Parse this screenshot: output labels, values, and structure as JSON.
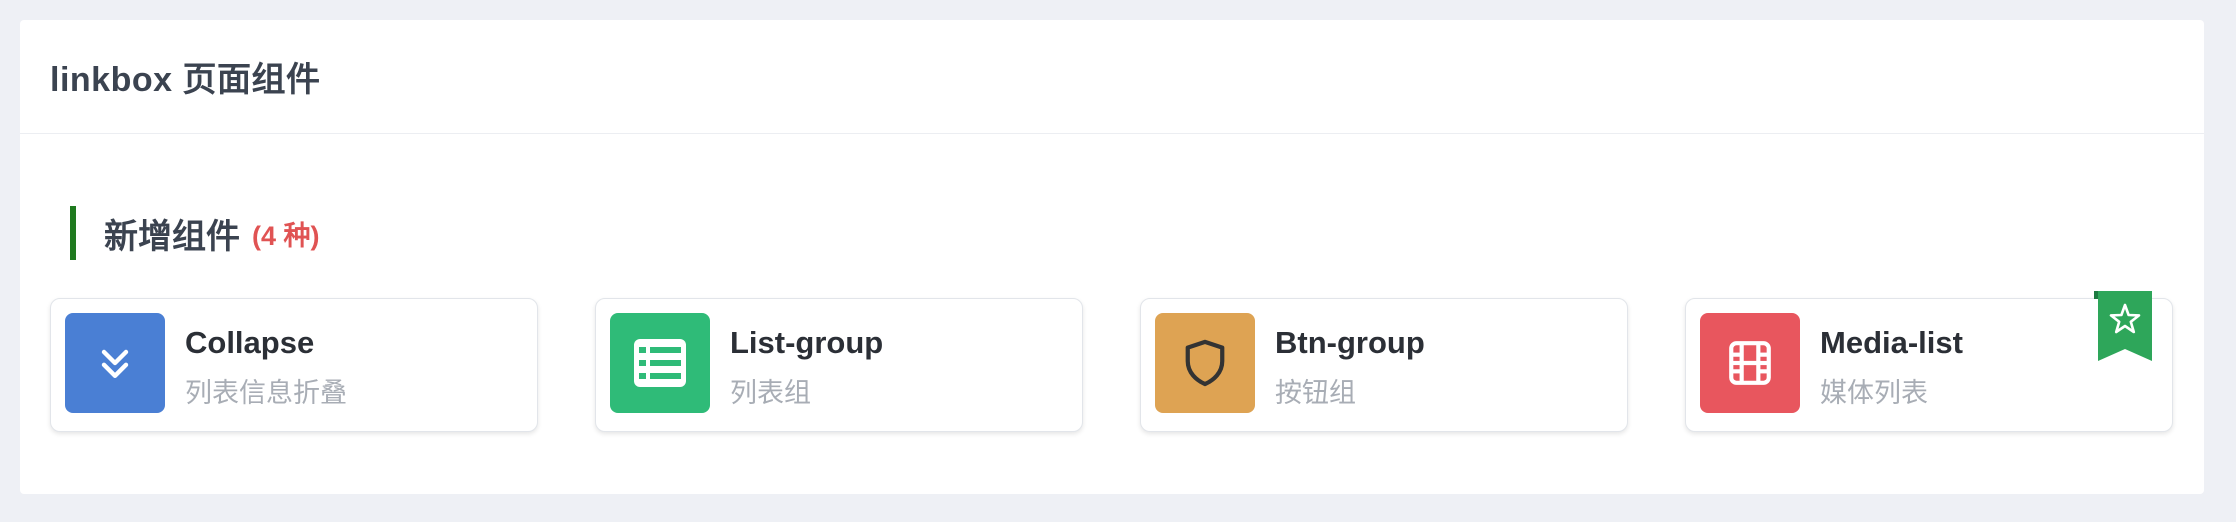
{
  "panel": {
    "title": "linkbox 页面组件"
  },
  "section": {
    "title": "新增组件",
    "count": "(4 种)",
    "accent_color": "#1f7a1f",
    "count_color": "#e05353"
  },
  "cards": [
    {
      "name": "Collapse",
      "desc": "列表信息折叠",
      "icon": "chevrons-down-icon",
      "color": "#4a7fd4"
    },
    {
      "name": "List-group",
      "desc": "列表组",
      "icon": "table-list-icon",
      "color": "#2fbb78"
    },
    {
      "name": "Btn-group",
      "desc": "按钮组",
      "icon": "shield-icon",
      "color": "#dea353"
    },
    {
      "name": "Media-list",
      "desc": "媒体列表",
      "icon": "film-icon",
      "color": "#e8565e",
      "badge": "star-bookmark-icon",
      "badge_color": "#2ea65a"
    }
  ]
}
